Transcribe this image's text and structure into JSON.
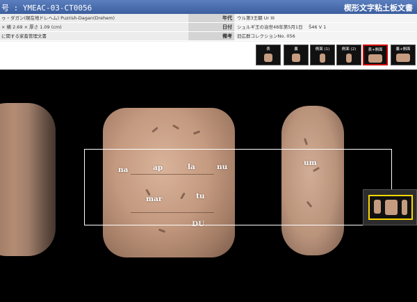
{
  "header": {
    "id_label": "号",
    "id_value": "YMEAC-03-CT0056",
    "site_title": "楔形文字粘土板文書"
  },
  "info": {
    "rows": [
      {
        "left": "ゥ・ダガン(現在地ドレヘム) Puzrish-Dagan(Drehem)",
        "head": "年代",
        "value": "ウル第3王朝 Ur III"
      },
      {
        "left": "× 横 2.69 × 厚さ 1.09 (cm)",
        "head": "日付",
        "value": "シュルギ王の治世48年第5月1日 　Š46 V 1"
      },
      {
        "left": "に関する家畜管理文書",
        "head": "備考",
        "value": "旧広群コレクションNo. 056"
      }
    ]
  },
  "toolbar": {
    "thumbs": [
      {
        "label": "表",
        "active": false
      },
      {
        "label": "裏",
        "active": false
      },
      {
        "label": "側面 (1)",
        "active": false
      },
      {
        "label": "側面 (2)",
        "active": false
      },
      {
        "label": "表+側面",
        "active": true
      },
      {
        "label": "裏+側面",
        "active": false
      }
    ]
  },
  "viewer": {
    "signs": {
      "na": "na",
      "ap": "ap",
      "la": "la",
      "nu": "nu",
      "mar": "mar",
      "tu": "tu",
      "um": "um",
      "du": "DU"
    }
  },
  "colors": {
    "header_bg": "#4a6eae",
    "active_thumb_border": "#cc0000",
    "selection_box": "#ffffff",
    "navigator_frame": "#ffd800",
    "clay": "#c59c80"
  }
}
